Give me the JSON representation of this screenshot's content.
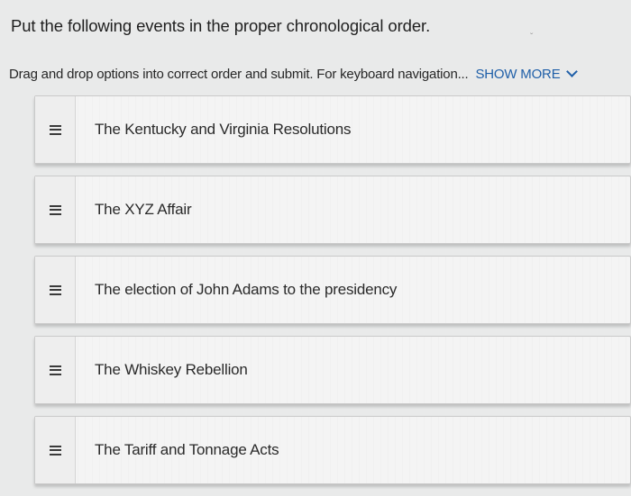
{
  "question": {
    "title": "Put the following events in the proper chronological order.",
    "instructions": "Drag and drop options into correct order and submit. For keyboard navigation...",
    "show_more_label": "SHOW MORE"
  },
  "options": [
    {
      "label": "The Kentucky and Virginia Resolutions"
    },
    {
      "label": "The XYZ Affair"
    },
    {
      "label": "The election of John Adams to the presidency"
    },
    {
      "label": "The Whiskey Rebellion"
    },
    {
      "label": "The Tariff and Tonnage Acts"
    }
  ],
  "colors": {
    "link": "#1f5fa8",
    "background": "#e9eaea",
    "card": "#f4f4f4"
  }
}
